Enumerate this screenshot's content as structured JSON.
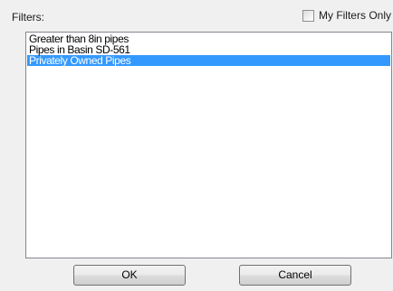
{
  "filters": {
    "label": "Filters:",
    "my_filters_only": {
      "label": "My Filters Only",
      "checked": false
    },
    "items": [
      {
        "label": "Greater than 8in pipes",
        "selected": false
      },
      {
        "label": "Pipes in Basin SD-561",
        "selected": false
      },
      {
        "label": "Privately Owned Pipes",
        "selected": true
      }
    ]
  },
  "buttons": {
    "ok_label": "OK",
    "cancel_label": "Cancel"
  },
  "colors": {
    "selection": "#3399ff",
    "background": "#f0f0f0"
  }
}
